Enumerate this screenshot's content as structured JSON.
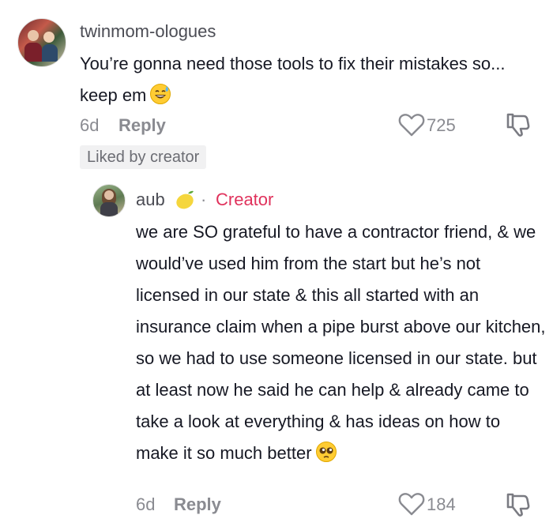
{
  "comment": {
    "username": "twinmom-ologues",
    "text": "You’re gonna need those tools to fix their mistakes so... keep em",
    "emoji": "sweat-smile-emoji",
    "age": "6d",
    "reply_label": "Reply",
    "likes": "725",
    "liked_badge": "Liked by creator"
  },
  "reply": {
    "username": "aub",
    "name_emoji": "lemon-emoji",
    "separator": "·",
    "creator_label": "Creator",
    "text": "we are SO grateful to have a contractor friend, & we would’ve used him from the start but he’s not licensed in our state & this all started with an insurance claim when a pipe burst above our kitchen, so we had to use someone licensed in our state. but at least now he said he can help & already came to take a look at everything & has ideas on how to make it so much better",
    "emoji": "pleading-face-emoji",
    "age": "6d",
    "reply_label": "Reply",
    "likes": "184"
  },
  "colors": {
    "text": "#161823",
    "muted": "#8a8b91",
    "username": "#4b4c54",
    "creator": "#e0325c",
    "badge_bg": "#f1f1f2"
  }
}
